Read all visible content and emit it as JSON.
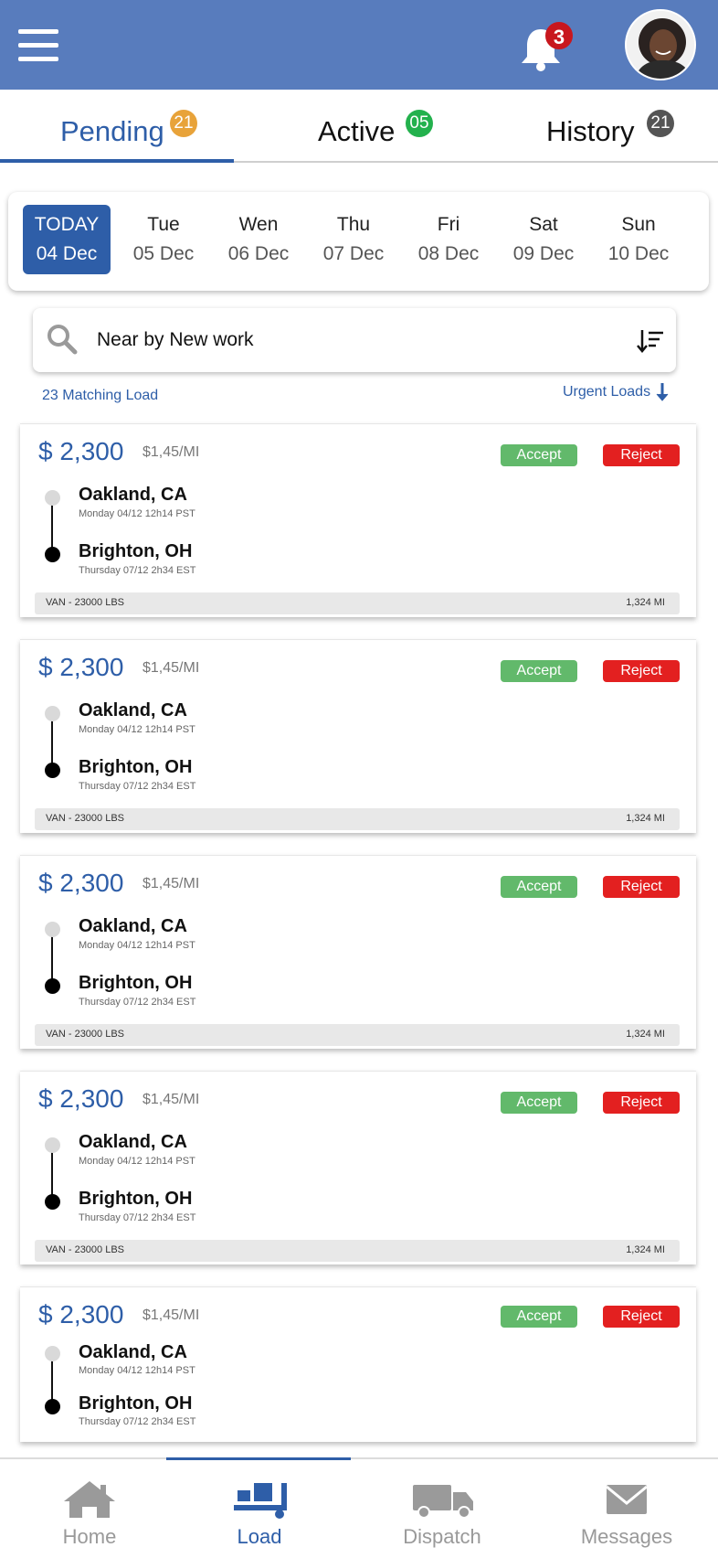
{
  "header": {
    "notification_count": "3"
  },
  "tabs": [
    {
      "label": "Pending",
      "badge": "21",
      "badge_color": "#e8a33a",
      "active": true
    },
    {
      "label": "Active",
      "badge": "05",
      "badge_color": "#23b14d",
      "active": false
    },
    {
      "label": "History",
      "badge": "21",
      "badge_color": "#555555",
      "active": false
    }
  ],
  "dates": [
    {
      "name": "TODAY",
      "day": "04 Dec",
      "selected": true
    },
    {
      "name": "Tue",
      "day": "05 Dec"
    },
    {
      "name": "Wen",
      "day": "06 Dec"
    },
    {
      "name": "Thu",
      "day": "07 Dec"
    },
    {
      "name": "Fri",
      "day": "08 Dec"
    },
    {
      "name": "Sat",
      "day": "09 Dec"
    },
    {
      "name": "Sun",
      "day": "10 Dec"
    }
  ],
  "search": {
    "value": "Near by New work"
  },
  "matching": "23 Matching Load",
  "urgent": "Urgent Loads",
  "loads": [
    {
      "price": "$ 2,300",
      "rate": "$1,45/MI",
      "accept": "Accept",
      "reject": "Reject",
      "origin": "Oakland, CA",
      "origin_meta": "Monday 04/12   12h14  PST",
      "dest": "Brighton, OH",
      "dest_meta": "Thursday  07/12   2h34  EST",
      "equipment": "VAN -  23000 LBS",
      "miles": "1,324 MI"
    },
    {
      "price": "$ 2,300",
      "rate": "$1,45/MI",
      "accept": "Accept",
      "reject": "Reject",
      "origin": "Oakland, CA",
      "origin_meta": "Monday 04/12   12h14  PST",
      "dest": "Brighton, OH",
      "dest_meta": "Thursday  07/12   2h34  EST",
      "equipment": "VAN -  23000 LBS",
      "miles": "1,324 MI"
    },
    {
      "price": "$ 2,300",
      "rate": "$1,45/MI",
      "accept": "Accept",
      "reject": "Reject",
      "origin": "Oakland, CA",
      "origin_meta": "Monday 04/12   12h14  PST",
      "dest": "Brighton, OH",
      "dest_meta": "Thursday  07/12   2h34  EST",
      "equipment": "VAN -  23000 LBS",
      "miles": "1,324 MI"
    },
    {
      "price": "$ 2,300",
      "rate": "$1,45/MI",
      "accept": "Accept",
      "reject": "Reject",
      "origin": "Oakland, CA",
      "origin_meta": "Monday 04/12   12h14  PST",
      "dest": "Brighton, OH",
      "dest_meta": "Thursday  07/12   2h34  EST",
      "equipment": "VAN -  23000 LBS",
      "miles": "1,324 MI"
    },
    {
      "price": "$ 2,300",
      "rate": "$1,45/MI",
      "accept": "Accept",
      "reject": "Reject",
      "origin": "Oakland, CA",
      "origin_meta": "Monday 04/12   12h14  PST",
      "dest": "Brighton, OH",
      "dest_meta": "Thursday  07/12   2h34  EST"
    }
  ],
  "nav": [
    {
      "label": "Home",
      "icon": "home-icon"
    },
    {
      "label": "Load",
      "icon": "load-icon",
      "active": true
    },
    {
      "label": "Dispatch",
      "icon": "truck-icon"
    },
    {
      "label": "Messages",
      "icon": "envelope-icon"
    }
  ],
  "colors": {
    "header": "#587cbd",
    "primary": "#2e5ea8",
    "accept": "#62b96b",
    "reject": "#e32020"
  }
}
